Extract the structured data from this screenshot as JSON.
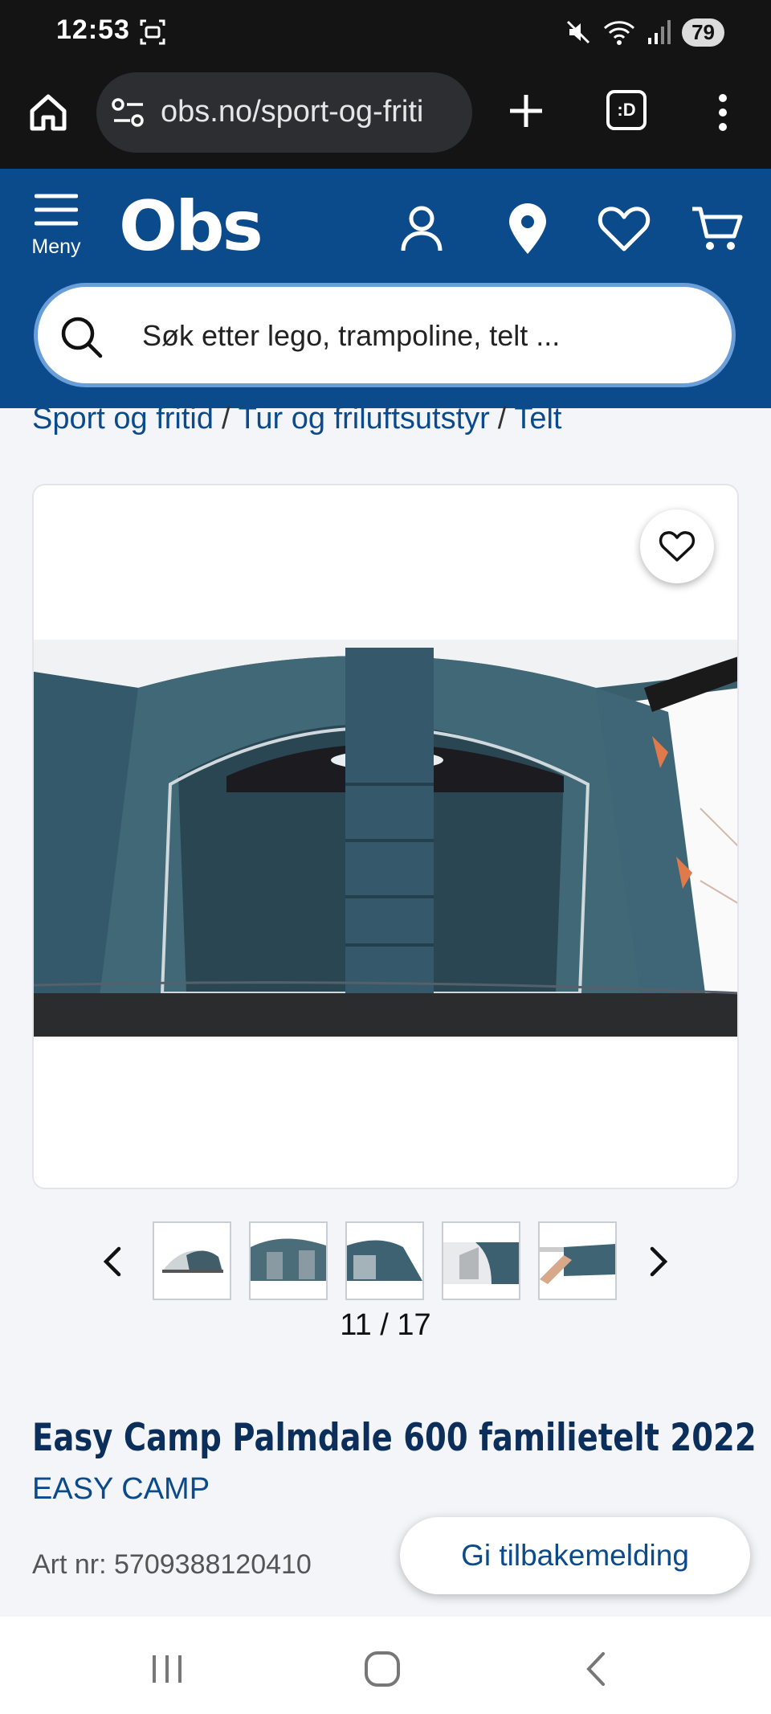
{
  "status_bar": {
    "time": "12:53",
    "battery": "79"
  },
  "browser": {
    "url": "obs.no/sport-og-friti",
    "tabs_label": ":D"
  },
  "header": {
    "menu_label": "Meny",
    "logo_text": "Obs",
    "search_placeholder": "Søk etter lego, trampoline, telt ..."
  },
  "breadcrumb": {
    "items": [
      "Sport og fritid",
      "Tur og friluftsutstyr",
      "Telt"
    ],
    "separator": "/"
  },
  "gallery": {
    "counter": "11 / 17",
    "current": 11,
    "total": 17
  },
  "product": {
    "title": "Easy Camp Palmdale 600 familietelt 2022",
    "brand": "EASY CAMP",
    "art_nr": "Art nr: 5709388120410"
  },
  "feedback_button": "Gi tilbakemelding",
  "colors": {
    "brand_blue": "#0b4a8b",
    "tent_teal": "#3f6472"
  }
}
